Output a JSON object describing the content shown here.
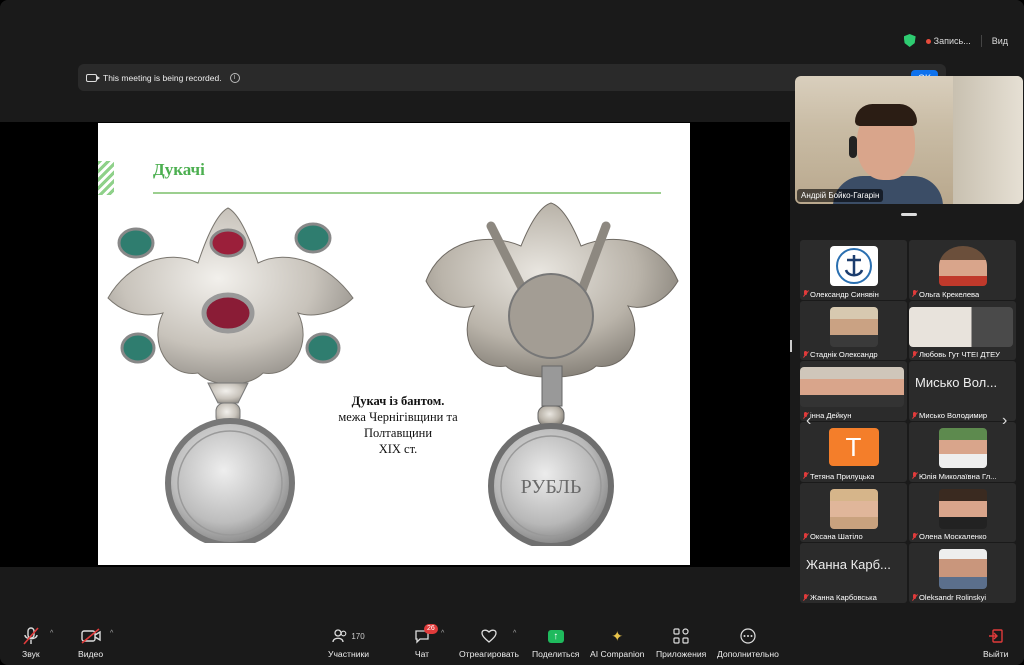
{
  "top_bar": {
    "recording_label": "Запись...",
    "view_label": "Вид"
  },
  "banner": {
    "message": "This meeting is being recorded.",
    "ok_label": "OK"
  },
  "slide": {
    "title": "Дукачі",
    "caption_bold": "Дукач із бантом.",
    "caption_lines": [
      "межа Чернігівщини та",
      "Полтавщини",
      "XIX ст."
    ],
    "coin_text": "РУБЛЬ"
  },
  "speaker": {
    "name": "Андрій Бойко-Гагарін"
  },
  "gallery": [
    {
      "name": "Олександр Синявін",
      "type": "logo"
    },
    {
      "name": "Ольга Крекелева",
      "type": "photo"
    },
    {
      "name": "Стаднік Олександр",
      "type": "photo"
    },
    {
      "name": "Любовь Гут ЧТЕІ ДТЕУ",
      "type": "photo"
    },
    {
      "name": "інна Дейкун",
      "type": "photo"
    },
    {
      "name": "Мисько Володимир",
      "type": "text",
      "display": "Мисько Вол..."
    },
    {
      "name": "Тетяна Прилуцька",
      "type": "letter",
      "display": "Т"
    },
    {
      "name": "Юлія Миколаївна Гл...",
      "type": "photo"
    },
    {
      "name": "Оксана Шатіло",
      "type": "photo"
    },
    {
      "name": "Олена Москаленко",
      "type": "photo"
    },
    {
      "name": "Жанна Карбовська",
      "type": "text",
      "display": "Жанна Карб..."
    },
    {
      "name": "Oleksandr Rolinskyi",
      "type": "photo"
    }
  ],
  "toolbar": {
    "audio_label": "Звук",
    "video_label": "Видео",
    "participants_label": "Участники",
    "participants_count": "170",
    "chat_label": "Чат",
    "chat_badge": "26",
    "react_label": "Отреагировать",
    "share_label": "Поделиться",
    "ai_label": "AI Companion",
    "apps_label": "Приложения",
    "more_label": "Дополнительно",
    "leave_label": "Выйти"
  },
  "colors": {
    "accent_blue": "#0e72ed",
    "share_green": "#1fba5d",
    "mute_red": "#e03b3b",
    "slide_green": "#4caf50"
  }
}
